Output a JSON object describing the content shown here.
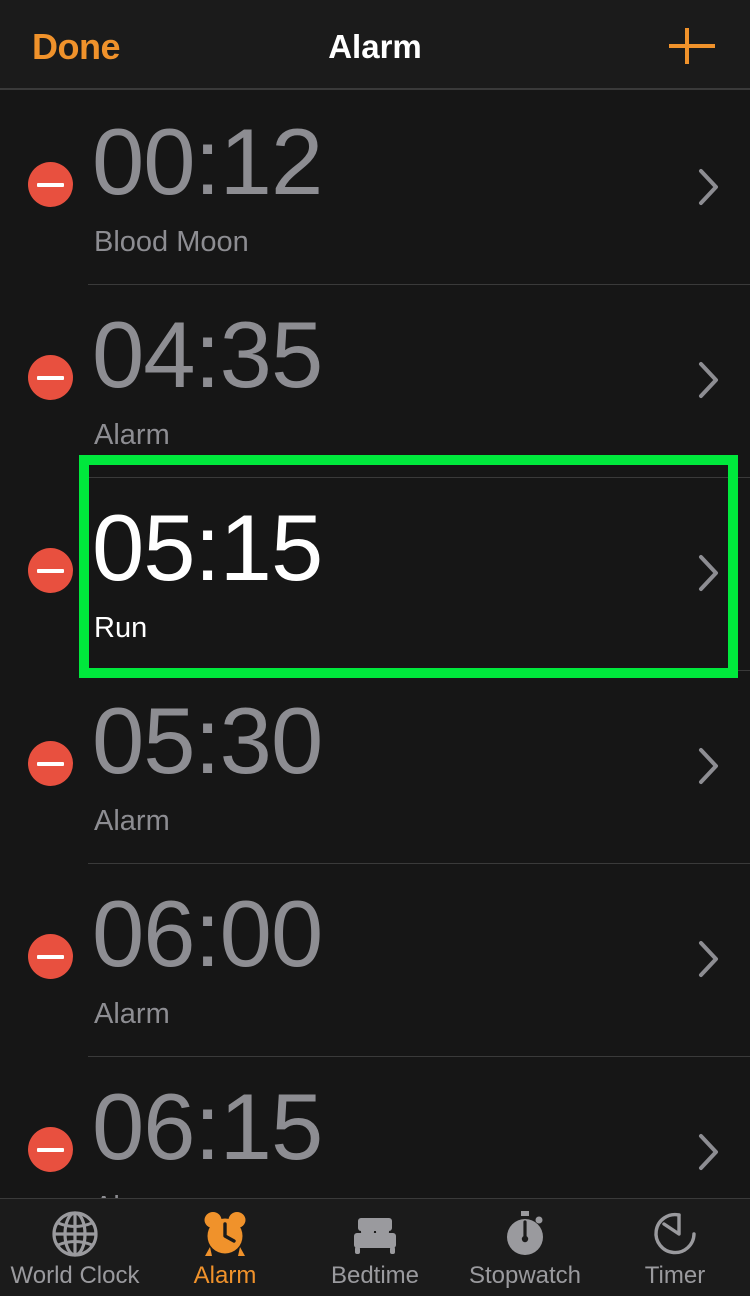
{
  "header": {
    "done_label": "Done",
    "title": "Alarm",
    "add_icon": "plus-icon",
    "accent_color": "#F0922B"
  },
  "colors": {
    "background": "#161616",
    "bar_background": "#1b1b1b",
    "accent_orange": "#F0922B",
    "delete_red": "#E8503F",
    "disabled_gray": "#8d8d92",
    "enabled_white": "#ffffff",
    "selection_green": "#00E83C",
    "separator": "#3a3a3a"
  },
  "alarms": [
    {
      "time": "00:12",
      "label": "Blood Moon",
      "enabled": false,
      "delete_icon": "minus-circle-icon",
      "disclosure_icon": "chevron-right-icon"
    },
    {
      "time": "04:35",
      "label": "Alarm",
      "enabled": false,
      "delete_icon": "minus-circle-icon",
      "disclosure_icon": "chevron-right-icon"
    },
    {
      "time": "05:15",
      "label": "Run",
      "enabled": true,
      "delete_icon": "minus-circle-icon",
      "disclosure_icon": "chevron-right-icon"
    },
    {
      "time": "05:30",
      "label": "Alarm",
      "enabled": false,
      "delete_icon": "minus-circle-icon",
      "disclosure_icon": "chevron-right-icon"
    },
    {
      "time": "06:00",
      "label": "Alarm",
      "enabled": false,
      "delete_icon": "minus-circle-icon",
      "disclosure_icon": "chevron-right-icon"
    },
    {
      "time": "06:15",
      "label": "Alarm",
      "enabled": false,
      "delete_icon": "minus-circle-icon",
      "disclosure_icon": "chevron-right-icon"
    }
  ],
  "selection": {
    "highlighted_alarm_index": 2,
    "highlighted_alarm_time": "05:15",
    "highlighted_alarm_label": "Run",
    "color": "#00E83C"
  },
  "tabs": [
    {
      "label": "World Clock",
      "icon": "globe-icon",
      "active": false
    },
    {
      "label": "Alarm",
      "icon": "alarm-clock-icon",
      "active": true
    },
    {
      "label": "Bedtime",
      "icon": "bed-icon",
      "active": false
    },
    {
      "label": "Stopwatch",
      "icon": "stopwatch-icon",
      "active": false
    },
    {
      "label": "Timer",
      "icon": "timer-icon",
      "active": false
    }
  ]
}
